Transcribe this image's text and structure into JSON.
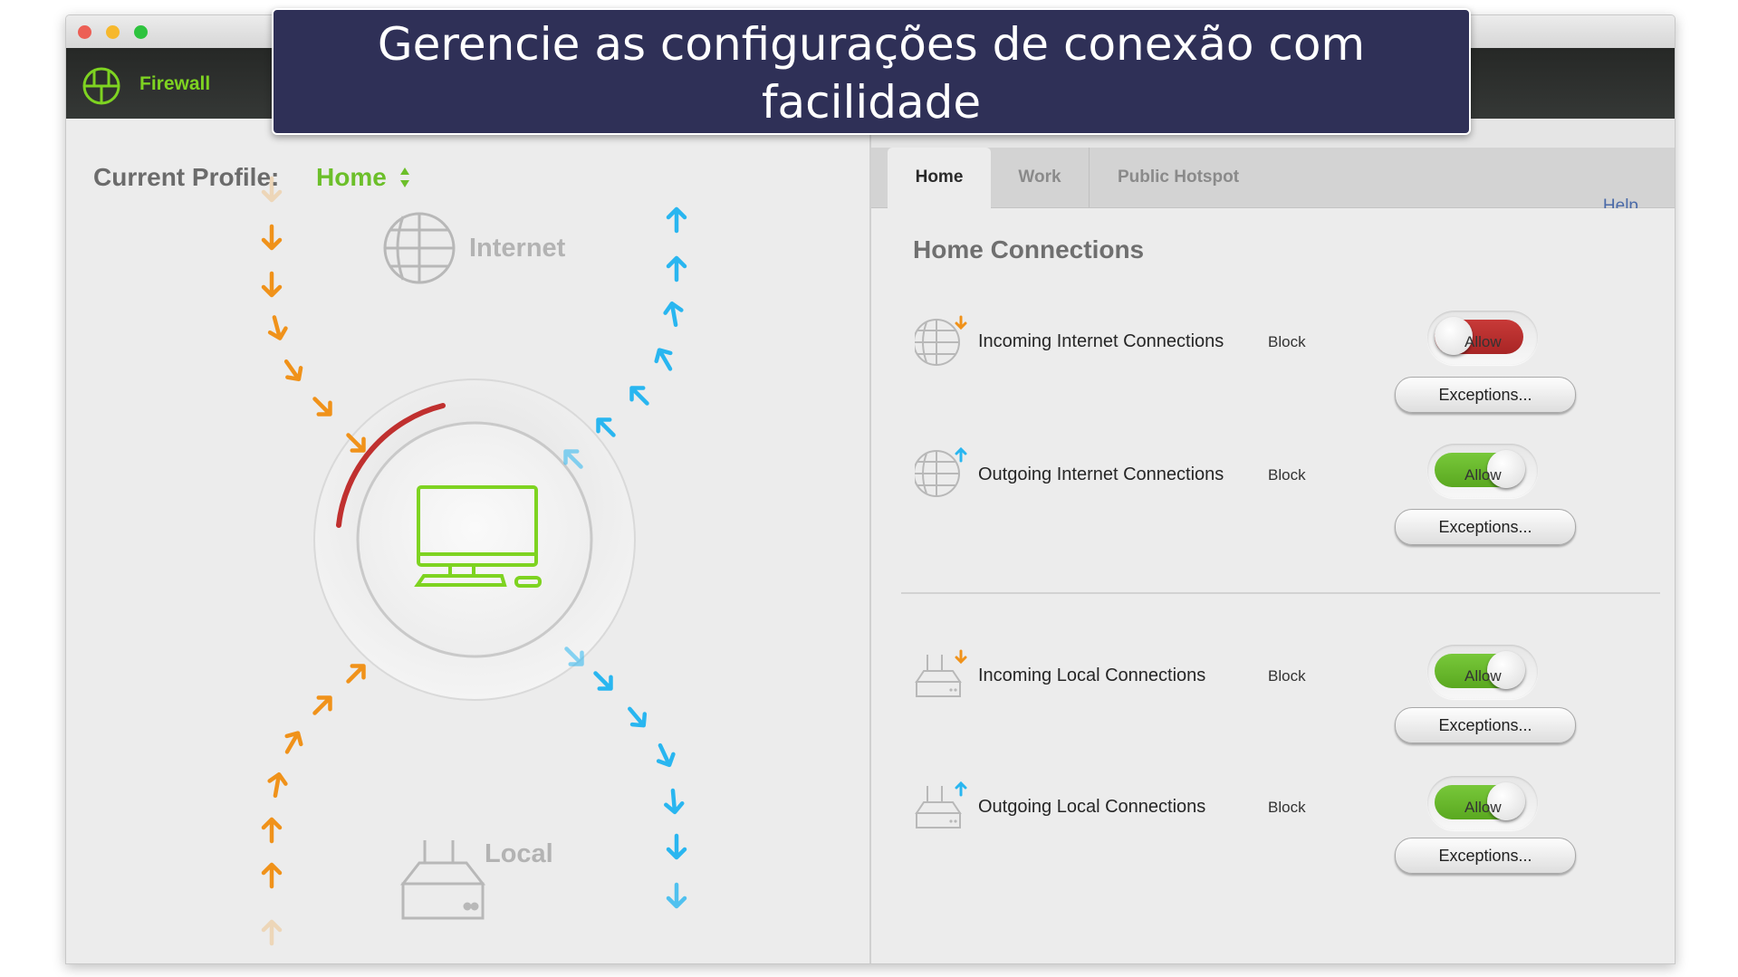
{
  "banner": {
    "text": "Gerencie as configurações de conexão com facilidade"
  },
  "window": {
    "app_name": "Firewall",
    "traffic_lights": [
      "close",
      "minimize",
      "zoom"
    ]
  },
  "left_panel": {
    "profile_label": "Current Profile:",
    "profile_value": "Home",
    "internet_label": "Internet",
    "local_label": "Local"
  },
  "tabs": [
    {
      "label": "Home",
      "active": true
    },
    {
      "label": "Work",
      "active": false
    },
    {
      "label": "Public Hotspot",
      "active": false
    }
  ],
  "help_label": "Help",
  "section_title": "Home Connections",
  "rows": [
    {
      "label": "Incoming Internet Connections",
      "icon": "globe-incoming-icon",
      "block": "Block",
      "allow": "Allow",
      "state": "block",
      "exceptions": "Exceptions..."
    },
    {
      "label": "Outgoing Internet Connections",
      "icon": "globe-outgoing-icon",
      "block": "Block",
      "allow": "Allow",
      "state": "allow",
      "exceptions": "Exceptions..."
    },
    {
      "label": "Incoming Local Connections",
      "icon": "router-incoming-icon",
      "block": "Block",
      "allow": "Allow",
      "state": "allow",
      "exceptions": "Exceptions..."
    },
    {
      "label": "Outgoing Local Connections",
      "icon": "router-outgoing-icon",
      "block": "Block",
      "allow": "Allow",
      "state": "allow",
      "exceptions": "Exceptions..."
    }
  ],
  "colors": {
    "banner": "#2f3057",
    "accent_green": "#7ed321",
    "incoming_orange": "#f0921a",
    "outgoing_blue": "#29b6f0",
    "blocked_red": "#c0302f"
  }
}
